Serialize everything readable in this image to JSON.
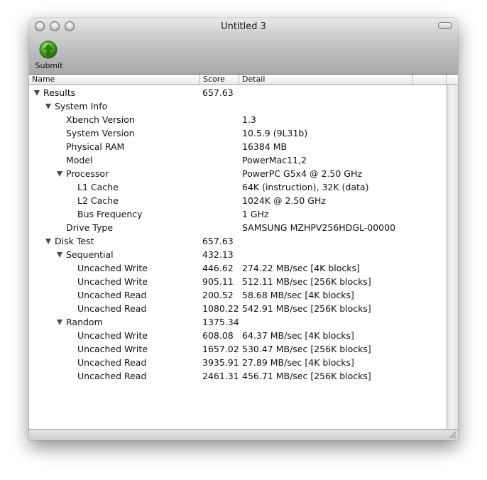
{
  "window": {
    "title": "Untitled 3"
  },
  "toolbar": {
    "submit_label": "Submit",
    "submit_icon": "green-up-arrow-icon",
    "submit_color": "#3a9a1c"
  },
  "columns": {
    "name": "Name",
    "score": "Score",
    "detail": "Detail"
  },
  "rows": [
    {
      "level": 0,
      "expanded": true,
      "name": "Results",
      "score": "657.63",
      "detail": ""
    },
    {
      "level": 1,
      "expanded": true,
      "name": "System Info",
      "score": "",
      "detail": ""
    },
    {
      "level": 2,
      "name": "Xbench Version",
      "score": "",
      "detail": "1.3"
    },
    {
      "level": 2,
      "name": "System Version",
      "score": "",
      "detail": "10.5.9 (9L31b)"
    },
    {
      "level": 2,
      "name": "Physical RAM",
      "score": "",
      "detail": "16384 MB"
    },
    {
      "level": 2,
      "name": "Model",
      "score": "",
      "detail": "PowerMac11,2"
    },
    {
      "level": 2,
      "expanded": true,
      "name": "Processor",
      "score": "",
      "detail": "PowerPC G5x4 @ 2.50 GHz"
    },
    {
      "level": 3,
      "name": "L1 Cache",
      "score": "",
      "detail": "64K (instruction), 32K (data)"
    },
    {
      "level": 3,
      "name": "L2 Cache",
      "score": "",
      "detail": "1024K @ 2.50 GHz"
    },
    {
      "level": 3,
      "name": "Bus Frequency",
      "score": "",
      "detail": "1 GHz"
    },
    {
      "level": 2,
      "name": "Drive Type",
      "score": "",
      "detail": "SAMSUNG MZHPV256HDGL-00000"
    },
    {
      "level": 1,
      "expanded": true,
      "name": "Disk Test",
      "score": "657.63",
      "detail": ""
    },
    {
      "level": 2,
      "expanded": true,
      "name": "Sequential",
      "score": "432.13",
      "detail": ""
    },
    {
      "level": 3,
      "name": "Uncached Write",
      "score": "446.62",
      "detail": "274.22 MB/sec [4K blocks]"
    },
    {
      "level": 3,
      "name": "Uncached Write",
      "score": "905.11",
      "detail": "512.11 MB/sec [256K blocks]"
    },
    {
      "level": 3,
      "name": "Uncached Read",
      "score": "200.52",
      "detail": "58.68 MB/sec [4K blocks]"
    },
    {
      "level": 3,
      "name": "Uncached Read",
      "score": "1080.22",
      "detail": "542.91 MB/sec [256K blocks]"
    },
    {
      "level": 2,
      "expanded": true,
      "name": "Random",
      "score": "1375.34",
      "detail": ""
    },
    {
      "level": 3,
      "name": "Uncached Write",
      "score": "608.08",
      "detail": "64.37 MB/sec [4K blocks]"
    },
    {
      "level": 3,
      "name": "Uncached Write",
      "score": "1657.02",
      "detail": "530.47 MB/sec [256K blocks]"
    },
    {
      "level": 3,
      "name": "Uncached Read",
      "score": "3935.91",
      "detail": "27.89 MB/sec [4K blocks]"
    },
    {
      "level": 3,
      "name": "Uncached Read",
      "score": "2461.31",
      "detail": "456.71 MB/sec [256K blocks]"
    }
  ]
}
